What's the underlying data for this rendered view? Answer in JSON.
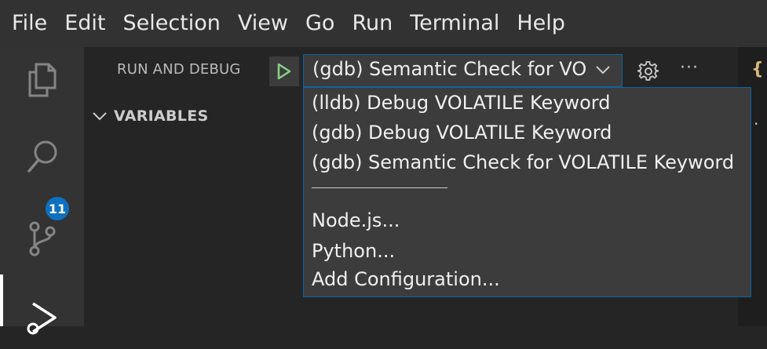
{
  "menubar": {
    "items": [
      "File",
      "Edit",
      "Selection",
      "View",
      "Go",
      "Run",
      "Terminal",
      "Help"
    ]
  },
  "activity": {
    "icons": [
      "explorer-icon",
      "search-icon",
      "source-control-icon",
      "run-debug-icon"
    ],
    "source_control_badge": "11"
  },
  "debug": {
    "title": "RUN AND DEBUG",
    "selected_config": "(gdb) Semantic Check for VOLATILE Keyword",
    "config_options": [
      "(lldb) Debug VOLATILE Keyword",
      "(gdb) Debug VOLATILE Keyword",
      "(gdb) Semantic Check for VOLATILE Keyword"
    ],
    "extra_options": [
      "Node.js...",
      "Python...",
      "Add Configuration..."
    ],
    "more_label": "···"
  },
  "sections": {
    "variables": "VARIABLES"
  },
  "editor": {
    "brace_glyph": "{",
    "dot_glyph": "."
  },
  "colors": {
    "accent": "#0e639c",
    "badge": "#0e70c0",
    "play": "#89d185"
  }
}
